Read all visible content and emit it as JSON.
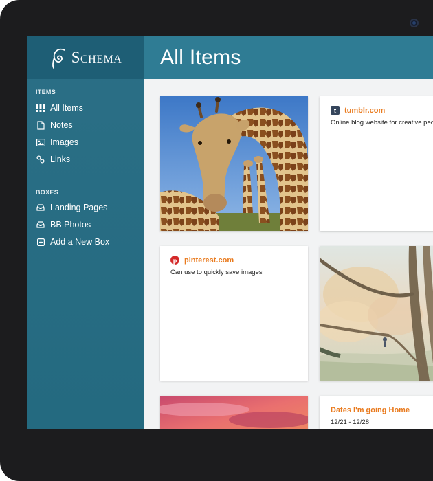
{
  "app": {
    "logo_text": "Schema",
    "page_title": "All Items"
  },
  "sidebar": {
    "items_heading": "ITEMS",
    "items": [
      {
        "label": "All Items",
        "icon": "grid-icon"
      },
      {
        "label": "Notes",
        "icon": "note-icon"
      },
      {
        "label": "Images",
        "icon": "image-icon"
      },
      {
        "label": "Links",
        "icon": "link-icon"
      }
    ],
    "boxes_heading": "BOXES",
    "boxes": [
      {
        "label": "Landing Pages",
        "icon": "inbox-icon"
      },
      {
        "label": "BB Photos",
        "icon": "inbox-icon"
      },
      {
        "label": "Add a New Box",
        "icon": "plus-square-icon"
      }
    ]
  },
  "cards": {
    "tumblr": {
      "title": "tumblr.com",
      "desc": "Online blog website for creative peo",
      "icon": "tumblr-icon"
    },
    "pinterest": {
      "title": "pinterest.com",
      "desc": "Can use to quickly save images",
      "icon": "pinterest-icon"
    },
    "note": {
      "title": "Dates I'm going Home",
      "sub": "12/21 - 12/28"
    }
  },
  "colors": {
    "sidebar": "#2b6f86",
    "logo_bar": "#1e5e75",
    "header": "#2f7c94",
    "accent_orange": "#e97a1d"
  }
}
